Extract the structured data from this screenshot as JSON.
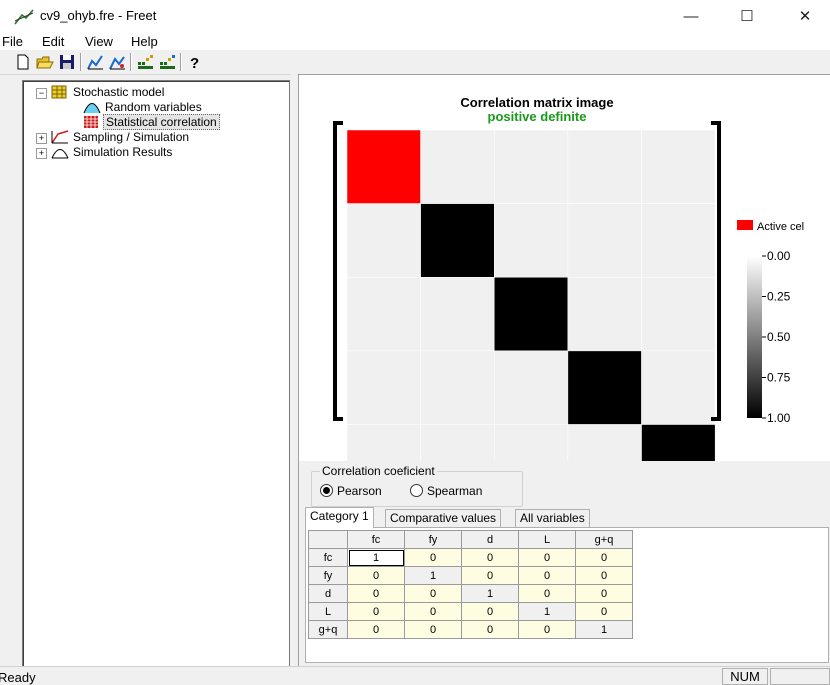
{
  "window": {
    "title": "cv9_ohyb.fre - Freet",
    "minimize": "—",
    "maximize": "☐",
    "close": "✕"
  },
  "menu": [
    "File",
    "Edit",
    "View",
    "Help"
  ],
  "toolbar": {
    "buttons": [
      "new-icon",
      "open-icon",
      "save-icon",
      "chart-icon",
      "chart-edit-icon",
      "matrix-icon",
      "matrix-edit-icon",
      "help-icon"
    ]
  },
  "tree": {
    "root": "Stochastic model",
    "children": [
      "Random variables",
      "Statistical correlation"
    ],
    "siblings": [
      "Sampling / Simulation",
      "Simulation Results"
    ],
    "selected": "Statistical correlation"
  },
  "chart": {
    "title": "Correlation matrix image",
    "subtitle": "positive definite",
    "subtitle_color": "#1a9a1a",
    "active_color": "#ff0000",
    "legend_active": "Active cel",
    "scale_ticks": [
      "0.00",
      "0.25",
      "0.50",
      "0.75",
      "1.00"
    ]
  },
  "chart_data": {
    "type": "heatmap",
    "title": "Correlation matrix image",
    "subtitle": "positive definite",
    "matrix": [
      [
        1,
        0,
        0,
        0,
        0
      ],
      [
        0,
        1,
        0,
        0,
        0
      ],
      [
        0,
        0,
        1,
        0,
        0
      ],
      [
        0,
        0,
        0,
        1,
        0
      ],
      [
        0,
        0,
        0,
        0,
        1
      ]
    ],
    "active_cell": [
      0,
      0
    ],
    "colorbar": {
      "min": 0.0,
      "max": 1.0,
      "ticks": [
        "0.00",
        "0.25",
        "0.50",
        "0.75",
        "1.00"
      ]
    }
  },
  "correlation": {
    "group_label": "Correlation coeficient",
    "options": [
      "Pearson",
      "Spearman"
    ],
    "selected": "Pearson"
  },
  "tabs": [
    "Category 1",
    "Comparative values",
    "All variables"
  ],
  "active_tab": "Category 1",
  "grid": {
    "headers": [
      "fc",
      "fy",
      "d",
      "L",
      "g+q"
    ],
    "rows": [
      {
        "label": "fc",
        "values": [
          "1",
          "0",
          "0",
          "0",
          "0"
        ]
      },
      {
        "label": "fy",
        "values": [
          "0",
          "1",
          "0",
          "0",
          "0"
        ]
      },
      {
        "label": "d",
        "values": [
          "0",
          "0",
          "1",
          "0",
          "0"
        ]
      },
      {
        "label": "L",
        "values": [
          "0",
          "0",
          "0",
          "1",
          "0"
        ]
      },
      {
        "label": "g+q",
        "values": [
          "0",
          "0",
          "0",
          "0",
          "1"
        ]
      }
    ]
  },
  "status": {
    "text": "Ready",
    "num": "NUM"
  }
}
